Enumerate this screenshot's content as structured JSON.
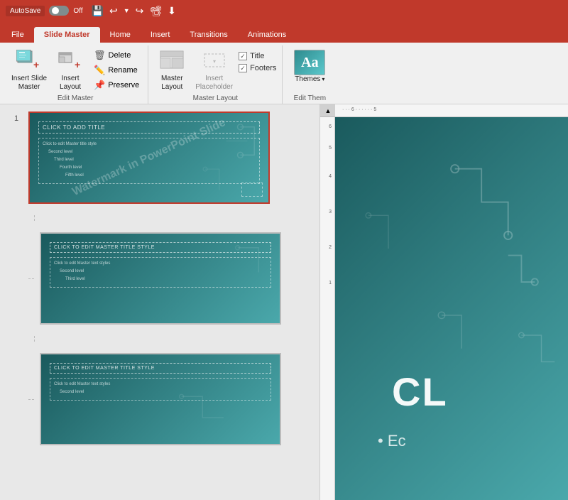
{
  "titlebar": {
    "autosave_label": "AutoSave",
    "toggle_state": "Off",
    "icons": [
      "save",
      "undo",
      "redo",
      "present",
      "more"
    ]
  },
  "tabs": [
    {
      "id": "file",
      "label": "File",
      "active": false
    },
    {
      "id": "slide-master",
      "label": "Slide Master",
      "active": true
    },
    {
      "id": "home",
      "label": "Home",
      "active": false
    },
    {
      "id": "insert",
      "label": "Insert",
      "active": false
    },
    {
      "id": "transitions",
      "label": "Transitions",
      "active": false
    },
    {
      "id": "animations",
      "label": "Animations",
      "active": false
    }
  ],
  "ribbon": {
    "groups": [
      {
        "id": "edit-master",
        "label": "Edit Master",
        "buttons_large": [
          {
            "id": "insert-slide-master",
            "label": "Insert Slide\nMaster"
          },
          {
            "id": "insert-layout",
            "label": "Insert\nLayout"
          }
        ],
        "buttons_small": [
          {
            "id": "delete",
            "label": "Delete"
          },
          {
            "id": "rename",
            "label": "Rename"
          },
          {
            "id": "preserve",
            "label": "Preserve"
          }
        ]
      },
      {
        "id": "master-layout",
        "label": "Master Layout",
        "buttons_large": [
          {
            "id": "master-layout-btn",
            "label": "Master\nLayout"
          }
        ],
        "buttons_secondary": [
          {
            "id": "insert-placeholder",
            "label": "Insert\nPlaceholder"
          }
        ],
        "checkboxes": [
          {
            "id": "title-cb",
            "label": "Title",
            "checked": true
          },
          {
            "id": "footers-cb",
            "label": "Footers",
            "checked": true
          }
        ]
      },
      {
        "id": "edit-theme",
        "label": "Edit Them",
        "buttons_large": [
          {
            "id": "themes-btn",
            "label": "Themes"
          }
        ]
      }
    ]
  },
  "slides": [
    {
      "id": 1,
      "number": "1",
      "selected": true,
      "title_text": "CLICK TO ADD TITLE",
      "content_lines": [
        "Click to edit Master title style",
        "Second level",
        "Third level",
        "Fourth level",
        "Fifth level"
      ],
      "watermark": "Watermark in PowerPoint Slide"
    },
    {
      "id": 2,
      "number": "",
      "selected": false,
      "title_text": "CLICK TO EDIT MASTER TITLE STYLE",
      "content_lines": [
        "Click to edit Master text styles",
        "Second level",
        "Third level"
      ]
    },
    {
      "id": 3,
      "number": "",
      "selected": false,
      "title_text": "CLICK TO EDIT MASTER TITLE STYLE",
      "content_lines": [
        "Click to edit Master text styles",
        "Second level"
      ]
    }
  ],
  "canvas": {
    "main_text": "CL",
    "bullet_text": "• Ec",
    "ruler_labels": [
      "6",
      "5",
      "4",
      "3",
      "2",
      "1"
    ]
  }
}
